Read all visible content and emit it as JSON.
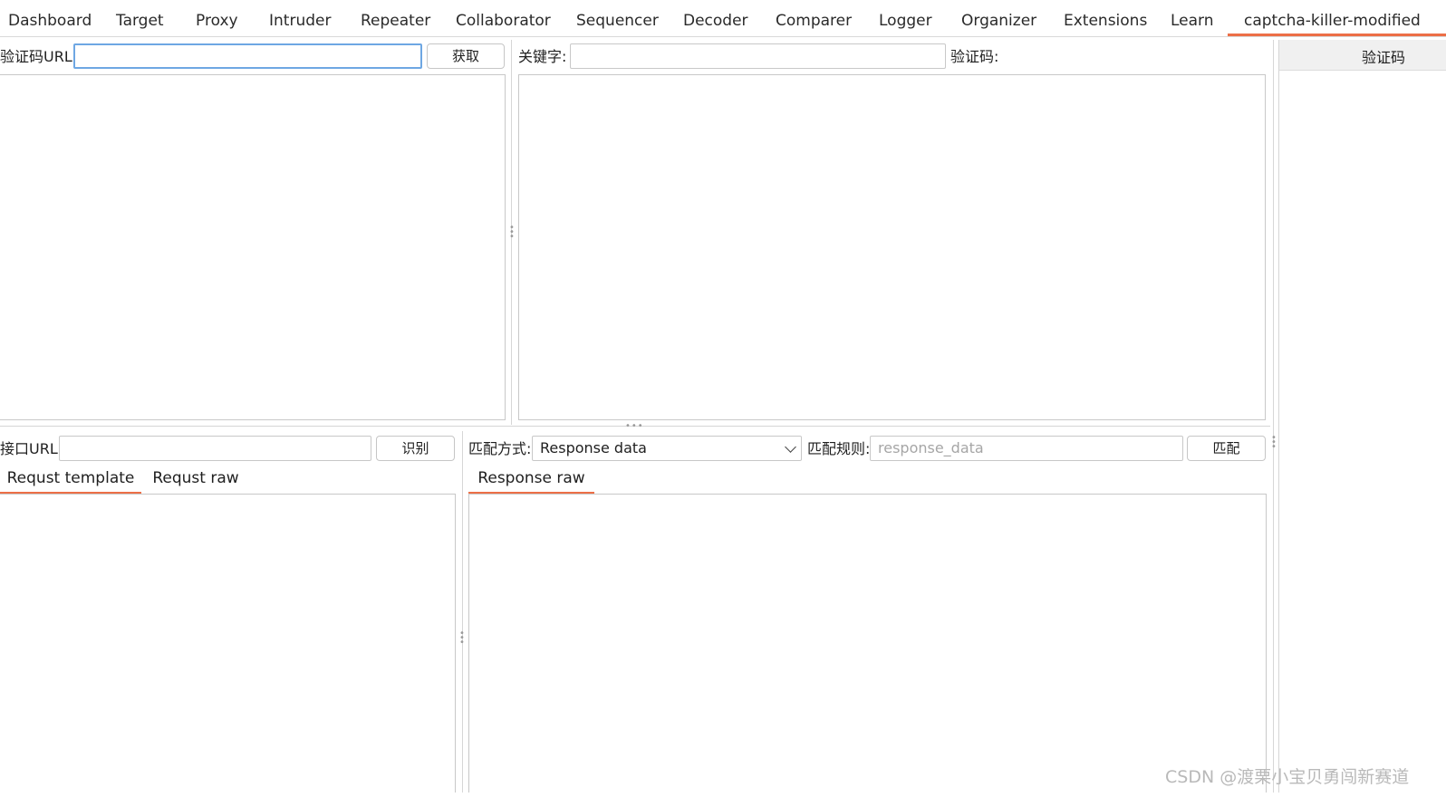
{
  "tabs": [
    {
      "label": "Dashboard"
    },
    {
      "label": "Target"
    },
    {
      "label": "Proxy"
    },
    {
      "label": "Intruder"
    },
    {
      "label": "Repeater"
    },
    {
      "label": "Collaborator"
    },
    {
      "label": "Sequencer"
    },
    {
      "label": "Decoder"
    },
    {
      "label": "Comparer"
    },
    {
      "label": "Logger"
    },
    {
      "label": "Organizer"
    },
    {
      "label": "Extensions"
    },
    {
      "label": "Learn"
    },
    {
      "label": "captcha-killer-modified",
      "active": true
    }
  ],
  "captcha": {
    "url_label": "验证码URL:",
    "url_value": "",
    "fetch_button": "获取",
    "keyword_label": "关键字:",
    "keyword_value": "",
    "code_label": "验证码:"
  },
  "right_panel": {
    "header": "验证码"
  },
  "api": {
    "url_label": "接口URL:",
    "url_value": "",
    "recognize_button": "识别",
    "request_tabs": [
      "Requst template",
      "Requst raw"
    ],
    "match_mode_label": "匹配方式:",
    "match_mode_value": "Response data",
    "match_rule_label": "匹配规则:",
    "match_rule_placeholder": "response_data",
    "match_button": "匹配",
    "response_tabs": [
      "Response raw"
    ]
  },
  "watermark": "CSDN @渡栗小宝贝勇闯新赛道",
  "colors": {
    "accent": "#ec6f47",
    "focus_border": "#6ea7e3"
  }
}
